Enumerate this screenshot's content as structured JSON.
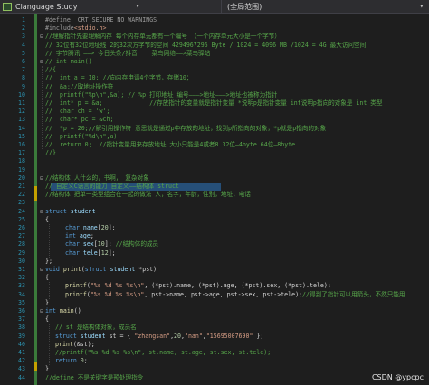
{
  "window": {
    "project_name": "Clanguage Study",
    "scope_label": "(全局范围)"
  },
  "dropdown_glyph": "▾",
  "watermark": "CSDN @ypcpc",
  "lines": [
    {
      "n": "1",
      "fold": "",
      "indent": 0,
      "tokens": [
        {
          "t": "#define ",
          "c": "c-pp"
        },
        {
          "t": "_CRT_SECURE_NO_WARNINGS",
          "c": "c-pp"
        }
      ]
    },
    {
      "n": "2",
      "fold": "",
      "indent": 0,
      "tokens": [
        {
          "t": "#include",
          "c": "c-pp"
        },
        {
          "t": "<stdio.h>",
          "c": "c-str"
        }
      ]
    },
    {
      "n": "3",
      "fold": "⊟",
      "indent": 0,
      "tokens": [
        {
          "t": "//理解指针先要理解内存 每个内存单元都有一个编号 （一个内存单元大小是一个字节）",
          "c": "c-cmt"
        }
      ]
    },
    {
      "n": "4",
      "fold": "",
      "indent": 0,
      "tokens": [
        {
          "t": "// 32位有32位地址线 2的32次方字节的空间 4294967296 Byte / 1024 = 4096 MB /1024 = 4G 最大访问空间",
          "c": "c-cmt"
        }
      ]
    },
    {
      "n": "5",
      "fold": "",
      "indent": 0,
      "tokens": [
        {
          "t": "// 字节腾讯 ——> 今日头条/抖音    菜鸟网络——>菜鸟驿站",
          "c": "c-cmt"
        }
      ]
    },
    {
      "n": "6",
      "fold": "⊟",
      "indent": 0,
      "tokens": [
        {
          "t": "// int main()",
          "c": "c-cmt"
        }
      ]
    },
    {
      "n": "7",
      "fold": "",
      "indent": 0,
      "tokens": [
        {
          "t": "//{",
          "c": "c-cmt"
        }
      ]
    },
    {
      "n": "8",
      "fold": "",
      "indent": 0,
      "tokens": [
        {
          "t": "//  int a = 10; //向内存申请4个字节，存储10；",
          "c": "c-cmt"
        }
      ]
    },
    {
      "n": "9",
      "fold": "",
      "indent": 0,
      "tokens": [
        {
          "t": "//  &a;//取地址操作符",
          "c": "c-cmt"
        }
      ]
    },
    {
      "n": "10",
      "fold": "",
      "indent": 0,
      "tokens": [
        {
          "t": "//  printf(\"%p\\n\",&a); // %p 打印地址 编号———>地址———>地址也被称为指针",
          "c": "c-cmt"
        }
      ]
    },
    {
      "n": "11",
      "fold": "",
      "indent": 0,
      "tokens": [
        {
          "t": "//  int* p = &a;             //存放指针的变量就是指针变量 *说明p是指针变量 int说明p指向的对象是 int 类型",
          "c": "c-cmt"
        }
      ]
    },
    {
      "n": "12",
      "fold": "",
      "indent": 0,
      "tokens": [
        {
          "t": "//  char ch = 'w';",
          "c": "c-cmt"
        }
      ]
    },
    {
      "n": "13",
      "fold": "",
      "indent": 0,
      "tokens": [
        {
          "t": "//  char* pc = &ch;",
          "c": "c-cmt"
        }
      ]
    },
    {
      "n": "14",
      "fold": "",
      "indent": 0,
      "tokens": [
        {
          "t": "//  *p = 20;//解引用操作符 意思就是通过p中存放的地址，找到p所指向的对象，*p就是p指向的对象",
          "c": "c-cmt"
        }
      ]
    },
    {
      "n": "15",
      "fold": "",
      "indent": 0,
      "tokens": [
        {
          "t": "//  printf(\"%d\\n\",a)",
          "c": "c-cmt"
        }
      ]
    },
    {
      "n": "16",
      "fold": "",
      "indent": 0,
      "tokens": [
        {
          "t": "//  return 0;  //指针变量用来存放地址 大小只能是4或者8 32位—4byte 64位—8byte",
          "c": "c-cmt"
        }
      ]
    },
    {
      "n": "17",
      "fold": "",
      "indent": 0,
      "tokens": [
        {
          "t": "//}",
          "c": "c-cmt"
        }
      ]
    },
    {
      "n": "18",
      "fold": "",
      "indent": 0,
      "tokens": []
    },
    {
      "n": "19",
      "fold": "",
      "indent": 0,
      "tokens": []
    },
    {
      "n": "20",
      "fold": "⊟",
      "indent": 0,
      "tokens": [
        {
          "t": "//结构体 人什么的，书啊， 复杂对象",
          "c": "c-cmt"
        }
      ]
    },
    {
      "n": "21",
      "fold": "",
      "indent": 0,
      "tokens": [
        {
          "t": "// 自定义C语言的能力 自定义——结构体 struct",
          "c": "c-cmt"
        }
      ]
    },
    {
      "n": "22",
      "fold": "",
      "indent": 0,
      "tokens": [
        {
          "t": "//结构体 把单一类型组合在一起的做法 人，名字，年龄，性别，地址，电话",
          "c": "c-cmt"
        }
      ]
    },
    {
      "n": "23",
      "fold": "",
      "indent": 0,
      "tokens": []
    },
    {
      "n": "24",
      "fold": "⊟",
      "indent": 0,
      "tokens": [
        {
          "t": "struct ",
          "c": "c-kw"
        },
        {
          "t": "student",
          "c": "c-var"
        }
      ]
    },
    {
      "n": "25",
      "fold": "",
      "indent": 0,
      "tokens": [
        {
          "t": "{",
          "c": ""
        }
      ]
    },
    {
      "n": "26",
      "fold": "",
      "indent": 2,
      "tokens": [
        {
          "t": "char ",
          "c": "c-kw"
        },
        {
          "t": "name",
          "c": "c-var"
        },
        {
          "t": "[",
          "c": ""
        },
        {
          "t": "20",
          "c": "c-num"
        },
        {
          "t": "];",
          "c": ""
        }
      ]
    },
    {
      "n": "27",
      "fold": "",
      "indent": 2,
      "tokens": [
        {
          "t": "int ",
          "c": "c-kw"
        },
        {
          "t": "age",
          "c": "c-var"
        },
        {
          "t": ";",
          "c": ""
        }
      ]
    },
    {
      "n": "28",
      "fold": "",
      "indent": 2,
      "tokens": [
        {
          "t": "char ",
          "c": "c-kw"
        },
        {
          "t": "sex",
          "c": "c-var"
        },
        {
          "t": "[",
          "c": ""
        },
        {
          "t": "10",
          "c": "c-num"
        },
        {
          "t": "]; ",
          "c": ""
        },
        {
          "t": "//结构体的成员",
          "c": "c-cmt"
        }
      ]
    },
    {
      "n": "29",
      "fold": "",
      "indent": 2,
      "tokens": [
        {
          "t": "char ",
          "c": "c-kw"
        },
        {
          "t": "tele",
          "c": "c-var"
        },
        {
          "t": "[",
          "c": ""
        },
        {
          "t": "12",
          "c": "c-num"
        },
        {
          "t": "];",
          "c": ""
        }
      ]
    },
    {
      "n": "30",
      "fold": "",
      "indent": 0,
      "tokens": [
        {
          "t": "};",
          "c": ""
        }
      ]
    },
    {
      "n": "31",
      "fold": "⊟",
      "indent": 0,
      "tokens": [
        {
          "t": "void ",
          "c": "c-kw"
        },
        {
          "t": "print",
          "c": "c-fn"
        },
        {
          "t": "(",
          "c": ""
        },
        {
          "t": "struct ",
          "c": "c-kw"
        },
        {
          "t": "student ",
          "c": "c-var"
        },
        {
          "t": "*pst)",
          "c": ""
        }
      ]
    },
    {
      "n": "32",
      "fold": "",
      "indent": 0,
      "tokens": [
        {
          "t": "{",
          "c": ""
        }
      ]
    },
    {
      "n": "33",
      "fold": "",
      "indent": 2,
      "tokens": [
        {
          "t": "printf",
          "c": "c-fn"
        },
        {
          "t": "(",
          "c": ""
        },
        {
          "t": "\"%s %d %s %s\\n\"",
          "c": "c-str"
        },
        {
          "t": ", (*pst).name, (*pst).age, (*pst).sex, (*pst).tele);",
          "c": ""
        }
      ]
    },
    {
      "n": "34",
      "fold": "",
      "indent": 2,
      "tokens": [
        {
          "t": "printf",
          "c": "c-fn"
        },
        {
          "t": "(",
          "c": ""
        },
        {
          "t": "\"%s %d %s %s\\n\"",
          "c": "c-str"
        },
        {
          "t": ", pst->name, pst->age, pst->sex, pst->tele);",
          "c": ""
        },
        {
          "t": "//得到了指针可以用箭头，不然只能用.",
          "c": "c-cmt"
        }
      ]
    },
    {
      "n": "35",
      "fold": "",
      "indent": 0,
      "tokens": [
        {
          "t": "}",
          "c": ""
        }
      ]
    },
    {
      "n": "36",
      "fold": "⊟",
      "indent": 0,
      "tokens": [
        {
          "t": "int ",
          "c": "c-kw"
        },
        {
          "t": "main",
          "c": "c-fn"
        },
        {
          "t": "()",
          "c": ""
        }
      ]
    },
    {
      "n": "37",
      "fold": "",
      "indent": 0,
      "tokens": [
        {
          "t": "{",
          "c": ""
        }
      ]
    },
    {
      "n": "38",
      "fold": "",
      "indent": 1,
      "tokens": [
        {
          "t": "// st 是结构体对象，成员名",
          "c": "c-cmt"
        }
      ]
    },
    {
      "n": "39",
      "fold": "",
      "indent": 1,
      "tokens": [
        {
          "t": "struct ",
          "c": "c-kw"
        },
        {
          "t": "student ",
          "c": "c-var"
        },
        {
          "t": "st = { ",
          "c": ""
        },
        {
          "t": "\"zhangsan\"",
          "c": "c-str"
        },
        {
          "t": ",",
          "c": ""
        },
        {
          "t": "20",
          "c": "c-num"
        },
        {
          "t": ",",
          "c": ""
        },
        {
          "t": "\"nan\"",
          "c": "c-str"
        },
        {
          "t": ",",
          "c": ""
        },
        {
          "t": "\"15695007690\"",
          "c": "c-str"
        },
        {
          "t": " };",
          "c": ""
        }
      ]
    },
    {
      "n": "40",
      "fold": "",
      "indent": 1,
      "tokens": [
        {
          "t": "print",
          "c": "c-fn"
        },
        {
          "t": "(&st);",
          "c": ""
        }
      ]
    },
    {
      "n": "41",
      "fold": "",
      "indent": 1,
      "tokens": [
        {
          "t": "//printf(\"%s %d %s %s\\n\", st.name, st.age, st.sex, st.tele);",
          "c": "c-cmt"
        }
      ]
    },
    {
      "n": "42",
      "fold": "",
      "indent": 1,
      "tokens": [
        {
          "t": "return ",
          "c": "c-kw"
        },
        {
          "t": "0",
          "c": "c-num"
        },
        {
          "t": ";",
          "c": ""
        }
      ]
    },
    {
      "n": "43",
      "fold": "",
      "indent": 0,
      "tokens": [
        {
          "t": "}",
          "c": ""
        }
      ]
    },
    {
      "n": "44",
      "fold": "",
      "indent": 0,
      "tokens": [
        {
          "t": "//define 不是关键字是预处理指令",
          "c": "c-cmt"
        }
      ]
    }
  ]
}
